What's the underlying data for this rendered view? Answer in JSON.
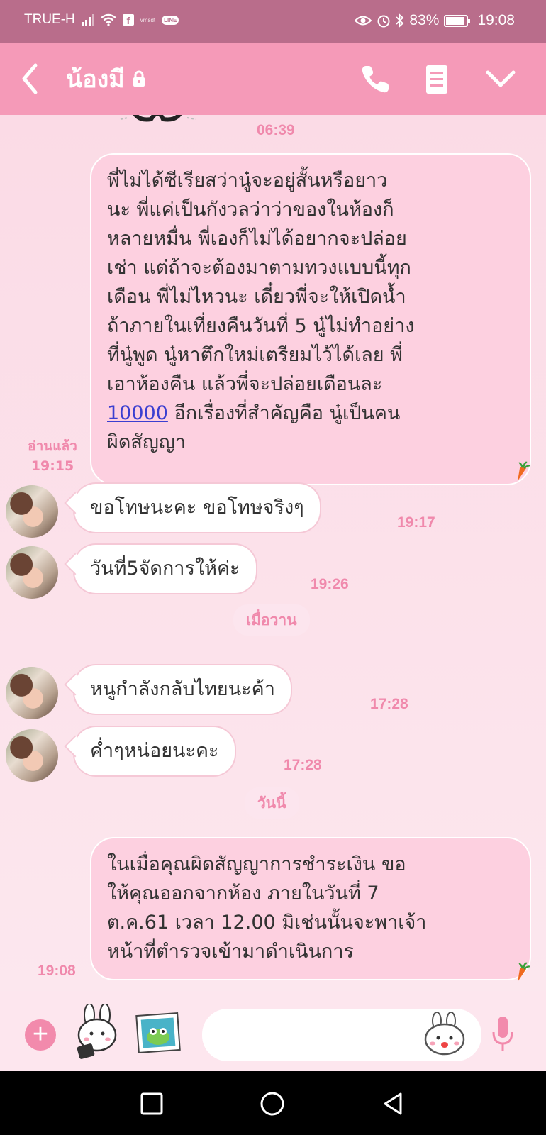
{
  "status_bar": {
    "carrier": "TRUE-H",
    "small_label": "vmsdt",
    "line_label": "LINE",
    "battery": "83%",
    "battery_level": 0.83,
    "time": "19:08"
  },
  "header": {
    "contact_name": "น้องมี"
  },
  "messages": {
    "sticker_time": "06:39",
    "m1": {
      "lines": [
        "พี่ไม่ได้ซีเรียสว่านู๋จะอยู่สั้นหรือยาว",
        "นะ  พี่แค่เป็นกังวลว่าว่าของในห้องก็",
        "หลายหมื่น พี่เองก็ไม่ได้อยากจะปล่อย",
        "เช่า  แต่ถ้าจะต้องมาตามทวงแบบนี้ทุก",
        "เดือน  พี่ไม่ไหวนะ  เดี๋ยวพี่จะให้เปิดน้ำ",
        "ถ้าภายในเที่ยงคืนวันที่ 5 นู๋ไม่ทำอย่าง",
        "ที่นู๋พูด นู๋หาตึกใหม่เตรียมไว้ได้เลย พี่",
        "เอาห้องคืน แล้วพี่จะปล่อยเดือนละ"
      ],
      "link_text": "10000",
      "line9_rest": " อีกเรื่องที่สำคัญคือ นู๋เป็นคน",
      "line10": "ผิดสัญญา",
      "read": "อ่านแล้ว",
      "time": "19:15"
    },
    "m2": {
      "text": "ขอโทษนะคะ ขอโทษจริงๆ",
      "time": "19:17"
    },
    "m3": {
      "text": "วันที่5จัดการให้ค่ะ",
      "time": "19:26"
    },
    "date1": "เมื่อวาน",
    "m4": {
      "text": "หนูกำลังกลับไทยนะค้า",
      "time": "17:28"
    },
    "m5": {
      "text": "ค่ำๆหน่อยนะคะ",
      "time": "17:28"
    },
    "date2": "วันนี้",
    "m6": {
      "lines": [
        "ในเมื่อคุณผิดสัญญาการชำระเงิน ขอ",
        "ให้คุณออกจากห้อง ภายในวันที่ 7",
        "ต.ค.61 เวลา 12.00 มิเช่นนั้นจะพาเจ้า",
        "หน้าที่ตำรวจเข้ามาดำเนินการ"
      ],
      "time": "19:08"
    }
  },
  "colors": {
    "header": "#f59ab8",
    "status_bar": "#b96d8b",
    "accent": "#f089ac",
    "outgoing_bubble": "#fdd0e0",
    "link": "#3b3fd0"
  },
  "icons": {
    "back": "chevron-left-icon",
    "lock": "lock-icon",
    "call": "phone-icon",
    "menu": "menu-icon",
    "dropdown": "chevron-down-icon",
    "plus": "plus-icon",
    "stickers": "sticker-icon",
    "gallery": "image-icon",
    "emoji": "emoji-icon",
    "mic": "microphone-icon"
  }
}
